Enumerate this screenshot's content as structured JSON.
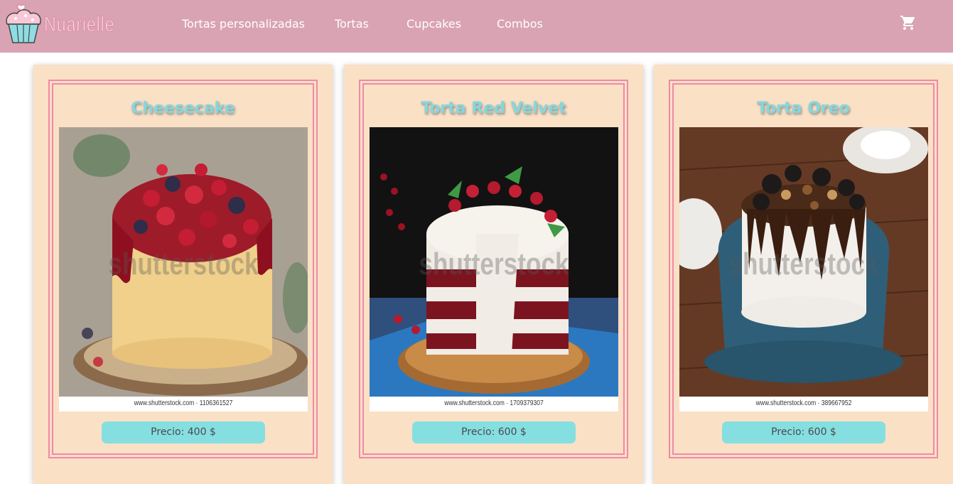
{
  "brand": {
    "name": "Nuarielle",
    "logo_icon": "cupcake-icon"
  },
  "nav": {
    "links": [
      {
        "label": "Tortas personalizadas"
      },
      {
        "label": "Tortas"
      },
      {
        "label": "Cupcakes"
      },
      {
        "label": "Combos"
      }
    ],
    "cart_icon": "shopping-cart-icon"
  },
  "colors": {
    "navbar": "#d9a3b3",
    "card_bg": "#fae0c5",
    "card_border": "#ef8aa6",
    "title_color": "#85d7dd",
    "price_bg": "#85dfe1"
  },
  "products": [
    {
      "title": "Cheesecake",
      "watermark": "shutterstock",
      "stock_id": "www.shutterstock.com · 1106361527",
      "price": "Precio: 400 $"
    },
    {
      "title": "Torta Red Velvet",
      "watermark": "shutterstock",
      "stock_id": "www.shutterstock.com · 1709379307",
      "price": "Precio: 600 $"
    },
    {
      "title": "Torta Oreo",
      "watermark": "shutterstock",
      "stock_id": "www.shutterstock.com · 389667952",
      "price": "Precio: 600 $"
    }
  ]
}
